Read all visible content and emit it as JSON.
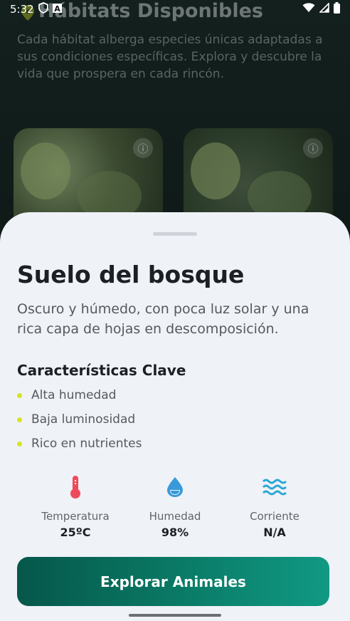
{
  "status_bar": {
    "time": "5:32",
    "icons_left": [
      "shield-icon",
      "a-letter-icon"
    ],
    "icons_right": [
      "wifi-icon",
      "signal-icon",
      "battery-icon"
    ]
  },
  "background": {
    "title": "Hábitats Disponibles",
    "description": "Cada hábitat alberga especies únicas adaptadas a sus condiciones específicas. Explora y descubre la vida que prospera en cada rincón.",
    "cards": [
      {
        "icon": "info-icon"
      },
      {
        "icon": "info-icon"
      }
    ]
  },
  "sheet": {
    "title": "Suelo del bosque",
    "description": "Oscuro y húmedo, con poca luz solar y una rica capa de hojas en descomposición.",
    "features_title": "Características Clave",
    "features": [
      "Alta humedad",
      "Baja luminosidad",
      "Rico en nutrientes"
    ],
    "stats": [
      {
        "icon": "thermometer-icon",
        "label": "Temperatura",
        "value": "25ºC"
      },
      {
        "icon": "water-drop-icon",
        "label": "Humedad",
        "value": "98%"
      },
      {
        "icon": "waves-icon",
        "label": "Corriente",
        "value": "N/A"
      }
    ],
    "button_label": "Explorar Animales"
  },
  "colors": {
    "accent_dot": "#d7e41e",
    "thermometer": "#ef4a5c",
    "water": "#3a9ad9",
    "waves": "#29a7d6",
    "button_start": "#06574a",
    "button_end": "#109984"
  }
}
